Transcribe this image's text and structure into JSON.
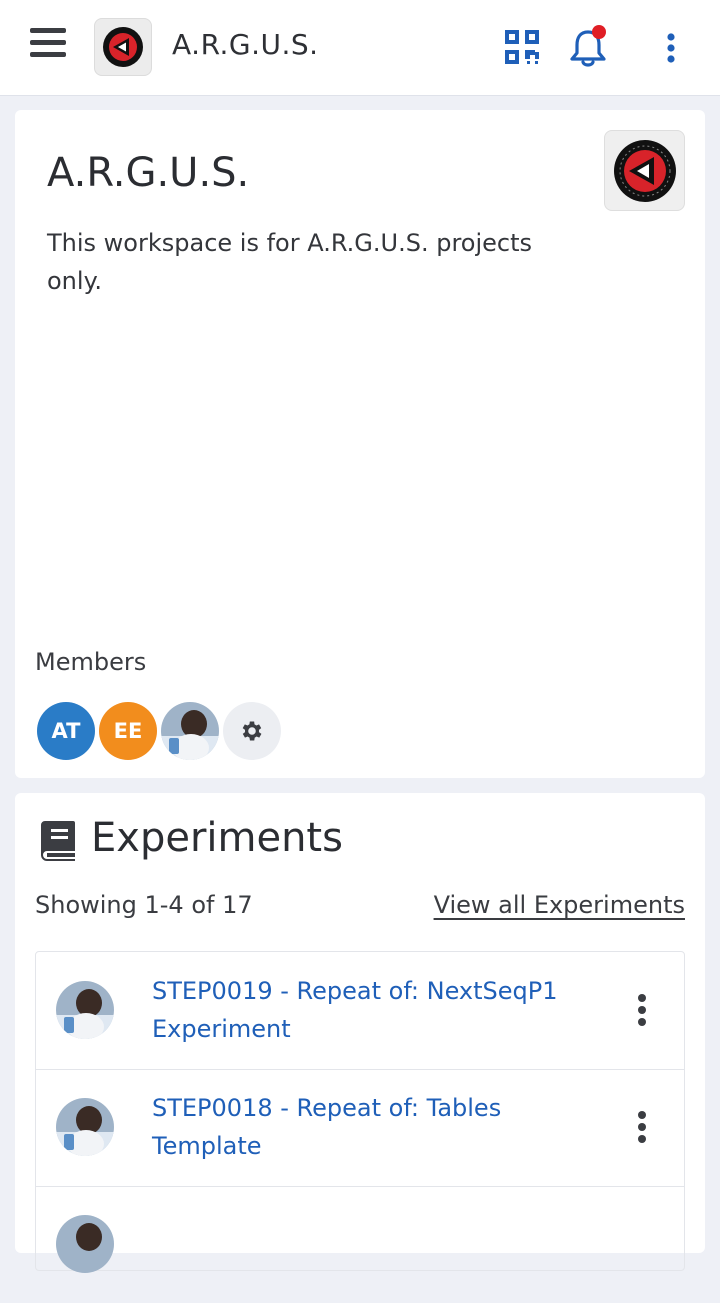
{
  "topbar": {
    "app_title": "A.R.G.U.S.",
    "icons": [
      "hamburger-menu-icon",
      "qr-code-icon",
      "bell-icon",
      "more-vertical-icon"
    ],
    "notification_dot_color": "#e01e25",
    "accent_color": "#1f5fb8"
  },
  "workspace": {
    "title": "A.R.G.U.S.",
    "description": "This workspace is for A.R.G.U.S. projects only.",
    "members_label": "Members",
    "members": [
      {
        "initials": "AT",
        "color": "#2a7cc7"
      },
      {
        "initials": "EE",
        "color": "#f28d1d"
      },
      {
        "initials": "",
        "type": "photo"
      }
    ]
  },
  "experiments": {
    "title": "Experiments",
    "showing": "Showing 1-4 of 17",
    "view_all": "View all Experiments",
    "items": [
      {
        "title": "STEP0019 - Repeat of: NextSeqP1 Experiment"
      },
      {
        "title": "STEP0018 - Repeat of: Tables Template"
      }
    ]
  }
}
